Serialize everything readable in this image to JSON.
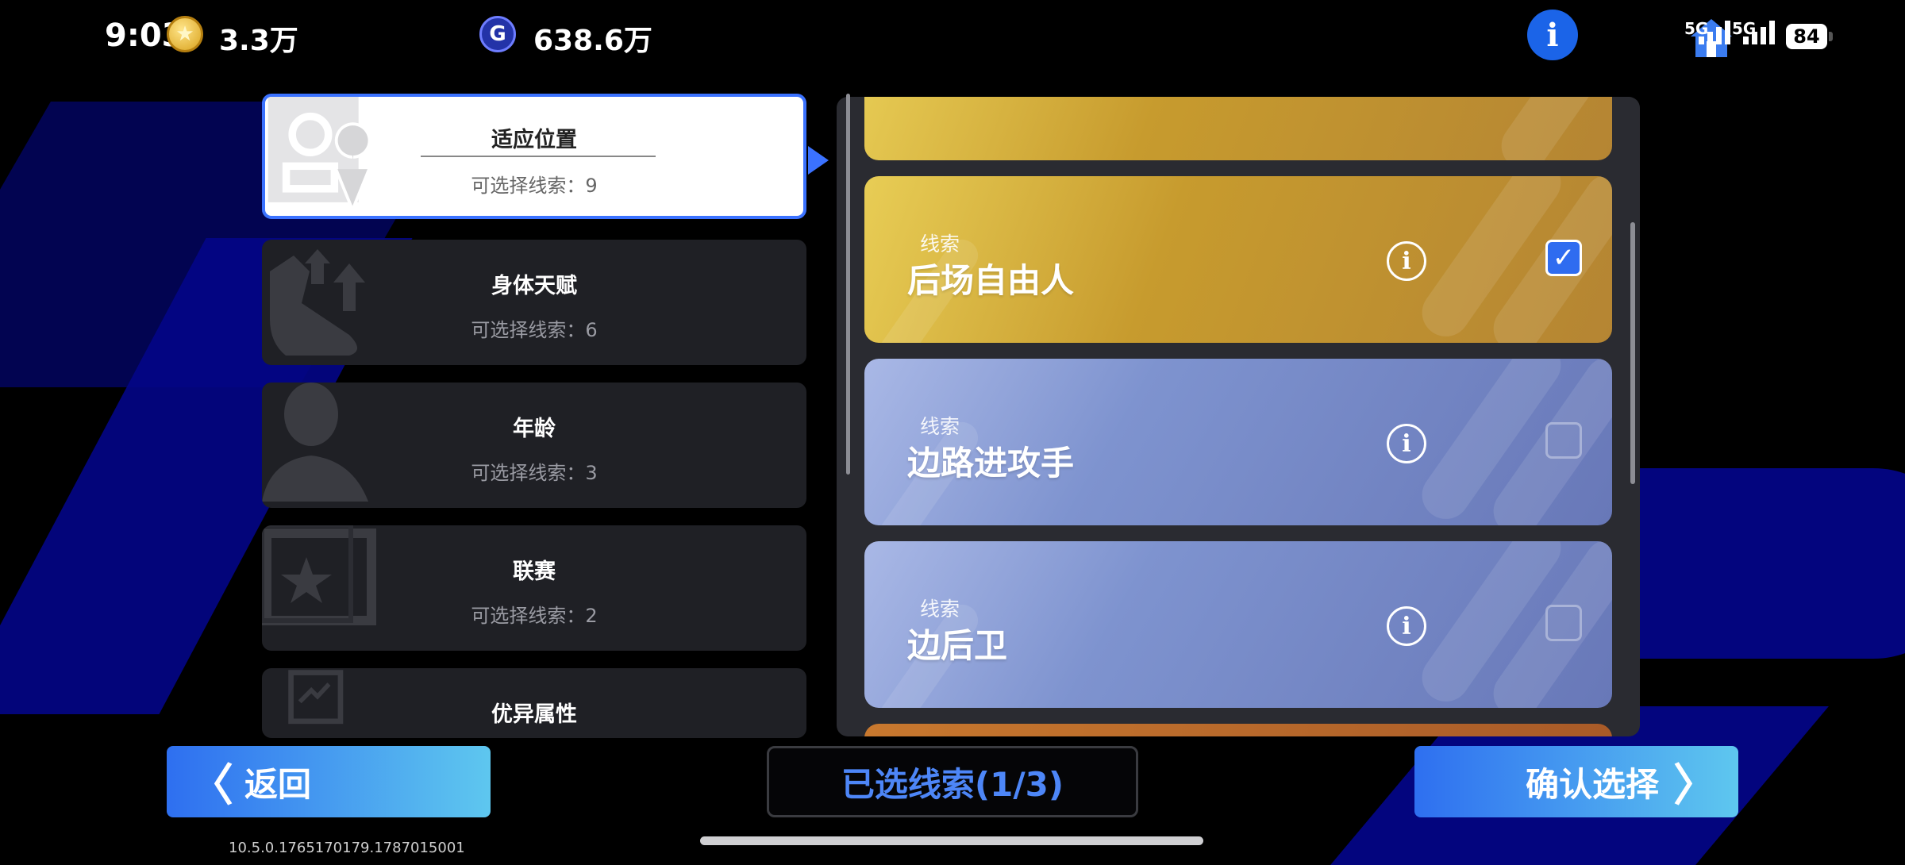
{
  "status_bar": {
    "time": "9:03",
    "network_1": "5G",
    "network_2": "5G",
    "battery": "84"
  },
  "currencies": [
    {
      "icon": "gold-coin-icon",
      "value": "3.3万"
    },
    {
      "icon": "g-coin-icon",
      "glyph": "G",
      "value": "638.6万"
    }
  ],
  "header": {
    "info_glyph": "i"
  },
  "categories": [
    {
      "title": "适应位置",
      "sub": "可选择线索：9",
      "selected": true
    },
    {
      "title": "身体天赋",
      "sub": "可选择线索：6",
      "selected": false
    },
    {
      "title": "年龄",
      "sub": "可选择线索：3",
      "selected": false
    },
    {
      "title": "联赛",
      "sub": "可选择线索：2",
      "selected": false
    },
    {
      "title": "优异属性",
      "sub": "",
      "selected": false
    }
  ],
  "clues": [
    {
      "label": "线索",
      "name": "后场自由人",
      "checked": true,
      "color": "gold"
    },
    {
      "label": "线索",
      "name": "边路进攻手",
      "checked": false,
      "color": "blue"
    },
    {
      "label": "线索",
      "name": "边后卫",
      "checked": false,
      "color": "blue"
    }
  ],
  "glyphs": {
    "info": "i",
    "check": "✓"
  },
  "bottom": {
    "back_arrow": "〈",
    "back_label": "返回",
    "selected_label": "已选线索(1/3)",
    "confirm_label": "确认选择",
    "confirm_arrow": "〉",
    "version": "10.5.0.1765170179.1787015001"
  },
  "colors": {
    "accent": "#3b72ff",
    "gold": "#c79b2e",
    "blue": "#7e93cf"
  }
}
